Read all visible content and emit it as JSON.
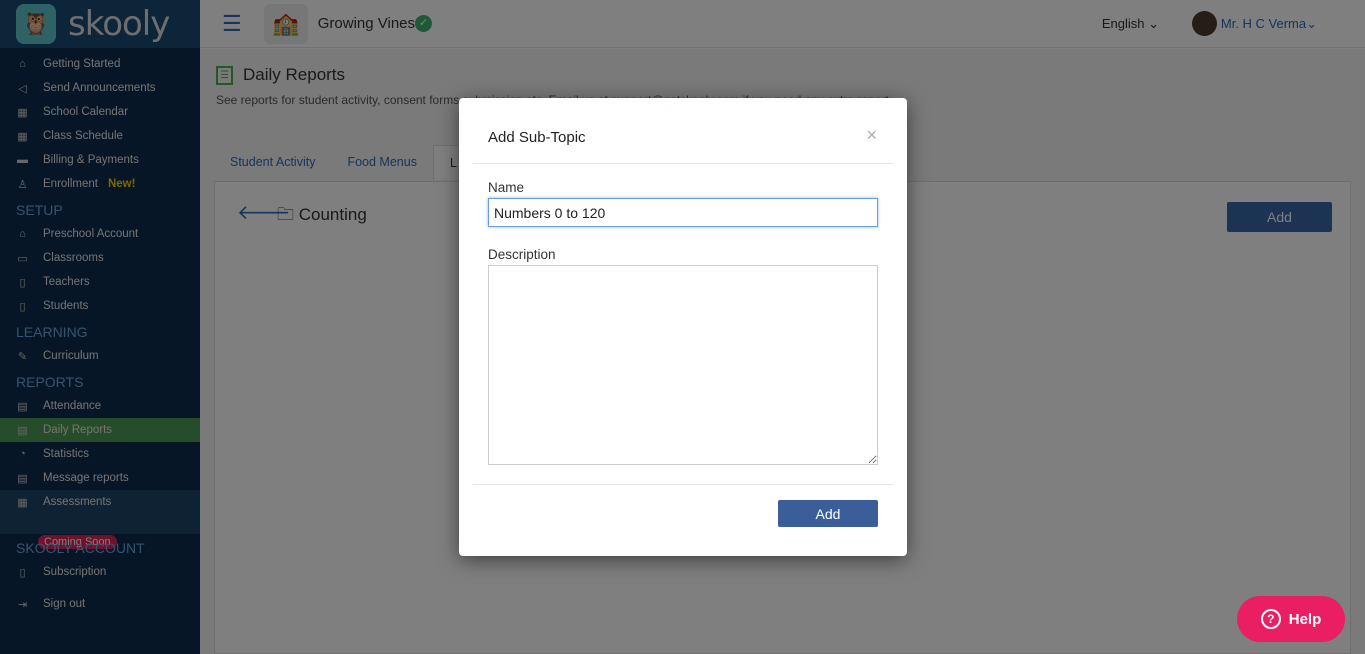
{
  "app": {
    "name": "skooly"
  },
  "sidebar": {
    "items": [
      {
        "label": "Getting Started",
        "icon": "home-icon"
      },
      {
        "label": "Send Announcements",
        "icon": "megaphone-icon"
      },
      {
        "label": "School Calendar",
        "icon": "calendar-icon"
      },
      {
        "label": "Class Schedule",
        "icon": "calendar-icon"
      },
      {
        "label": "Billing & Payments",
        "icon": "card-icon"
      },
      {
        "label": "Enrollment",
        "icon": "add-user-icon",
        "badge": "New!"
      }
    ],
    "setup_title": "SETUP",
    "setup": [
      {
        "label": "Preschool Account"
      },
      {
        "label": "Classrooms"
      },
      {
        "label": "Teachers"
      },
      {
        "label": "Students"
      }
    ],
    "learning_title": "LEARNING",
    "learning": [
      {
        "label": "Curriculum"
      }
    ],
    "reports_title": "REPORTS",
    "reports": [
      {
        "label": "Attendance"
      },
      {
        "label": "Daily Reports"
      },
      {
        "label": "Statistics"
      },
      {
        "label": "Message reports"
      },
      {
        "label": "Assessments",
        "badge": "Coming Soon"
      }
    ],
    "account_title": "SKOOLY ACCOUNT",
    "account": [
      {
        "label": "Subscription"
      },
      {
        "label": "Sign out"
      }
    ]
  },
  "topbar": {
    "school": "Growing Vines",
    "language": "English",
    "user": "Mr. H C Verma"
  },
  "page": {
    "title": "Daily Reports",
    "desc_before": "See reports for student activity, consent forms submission etc. Email us at ",
    "email": "support@getskooly.com",
    "desc_after": " if you need any extra report",
    "tabs": [
      "Student Activity",
      "Food Menus",
      "L"
    ],
    "folder": "Counting",
    "add": "Add"
  },
  "modal": {
    "title": "Add Sub-Topic",
    "close": "×",
    "name_label": "Name",
    "name_value": "Numbers 0 to 120",
    "desc_label": "Description",
    "desc_value": "",
    "submit": "Add"
  },
  "help": {
    "label": "Help"
  },
  "colors": {
    "accent": "#3a66a8",
    "active": "#4c9a52",
    "help": "#e91e63"
  }
}
